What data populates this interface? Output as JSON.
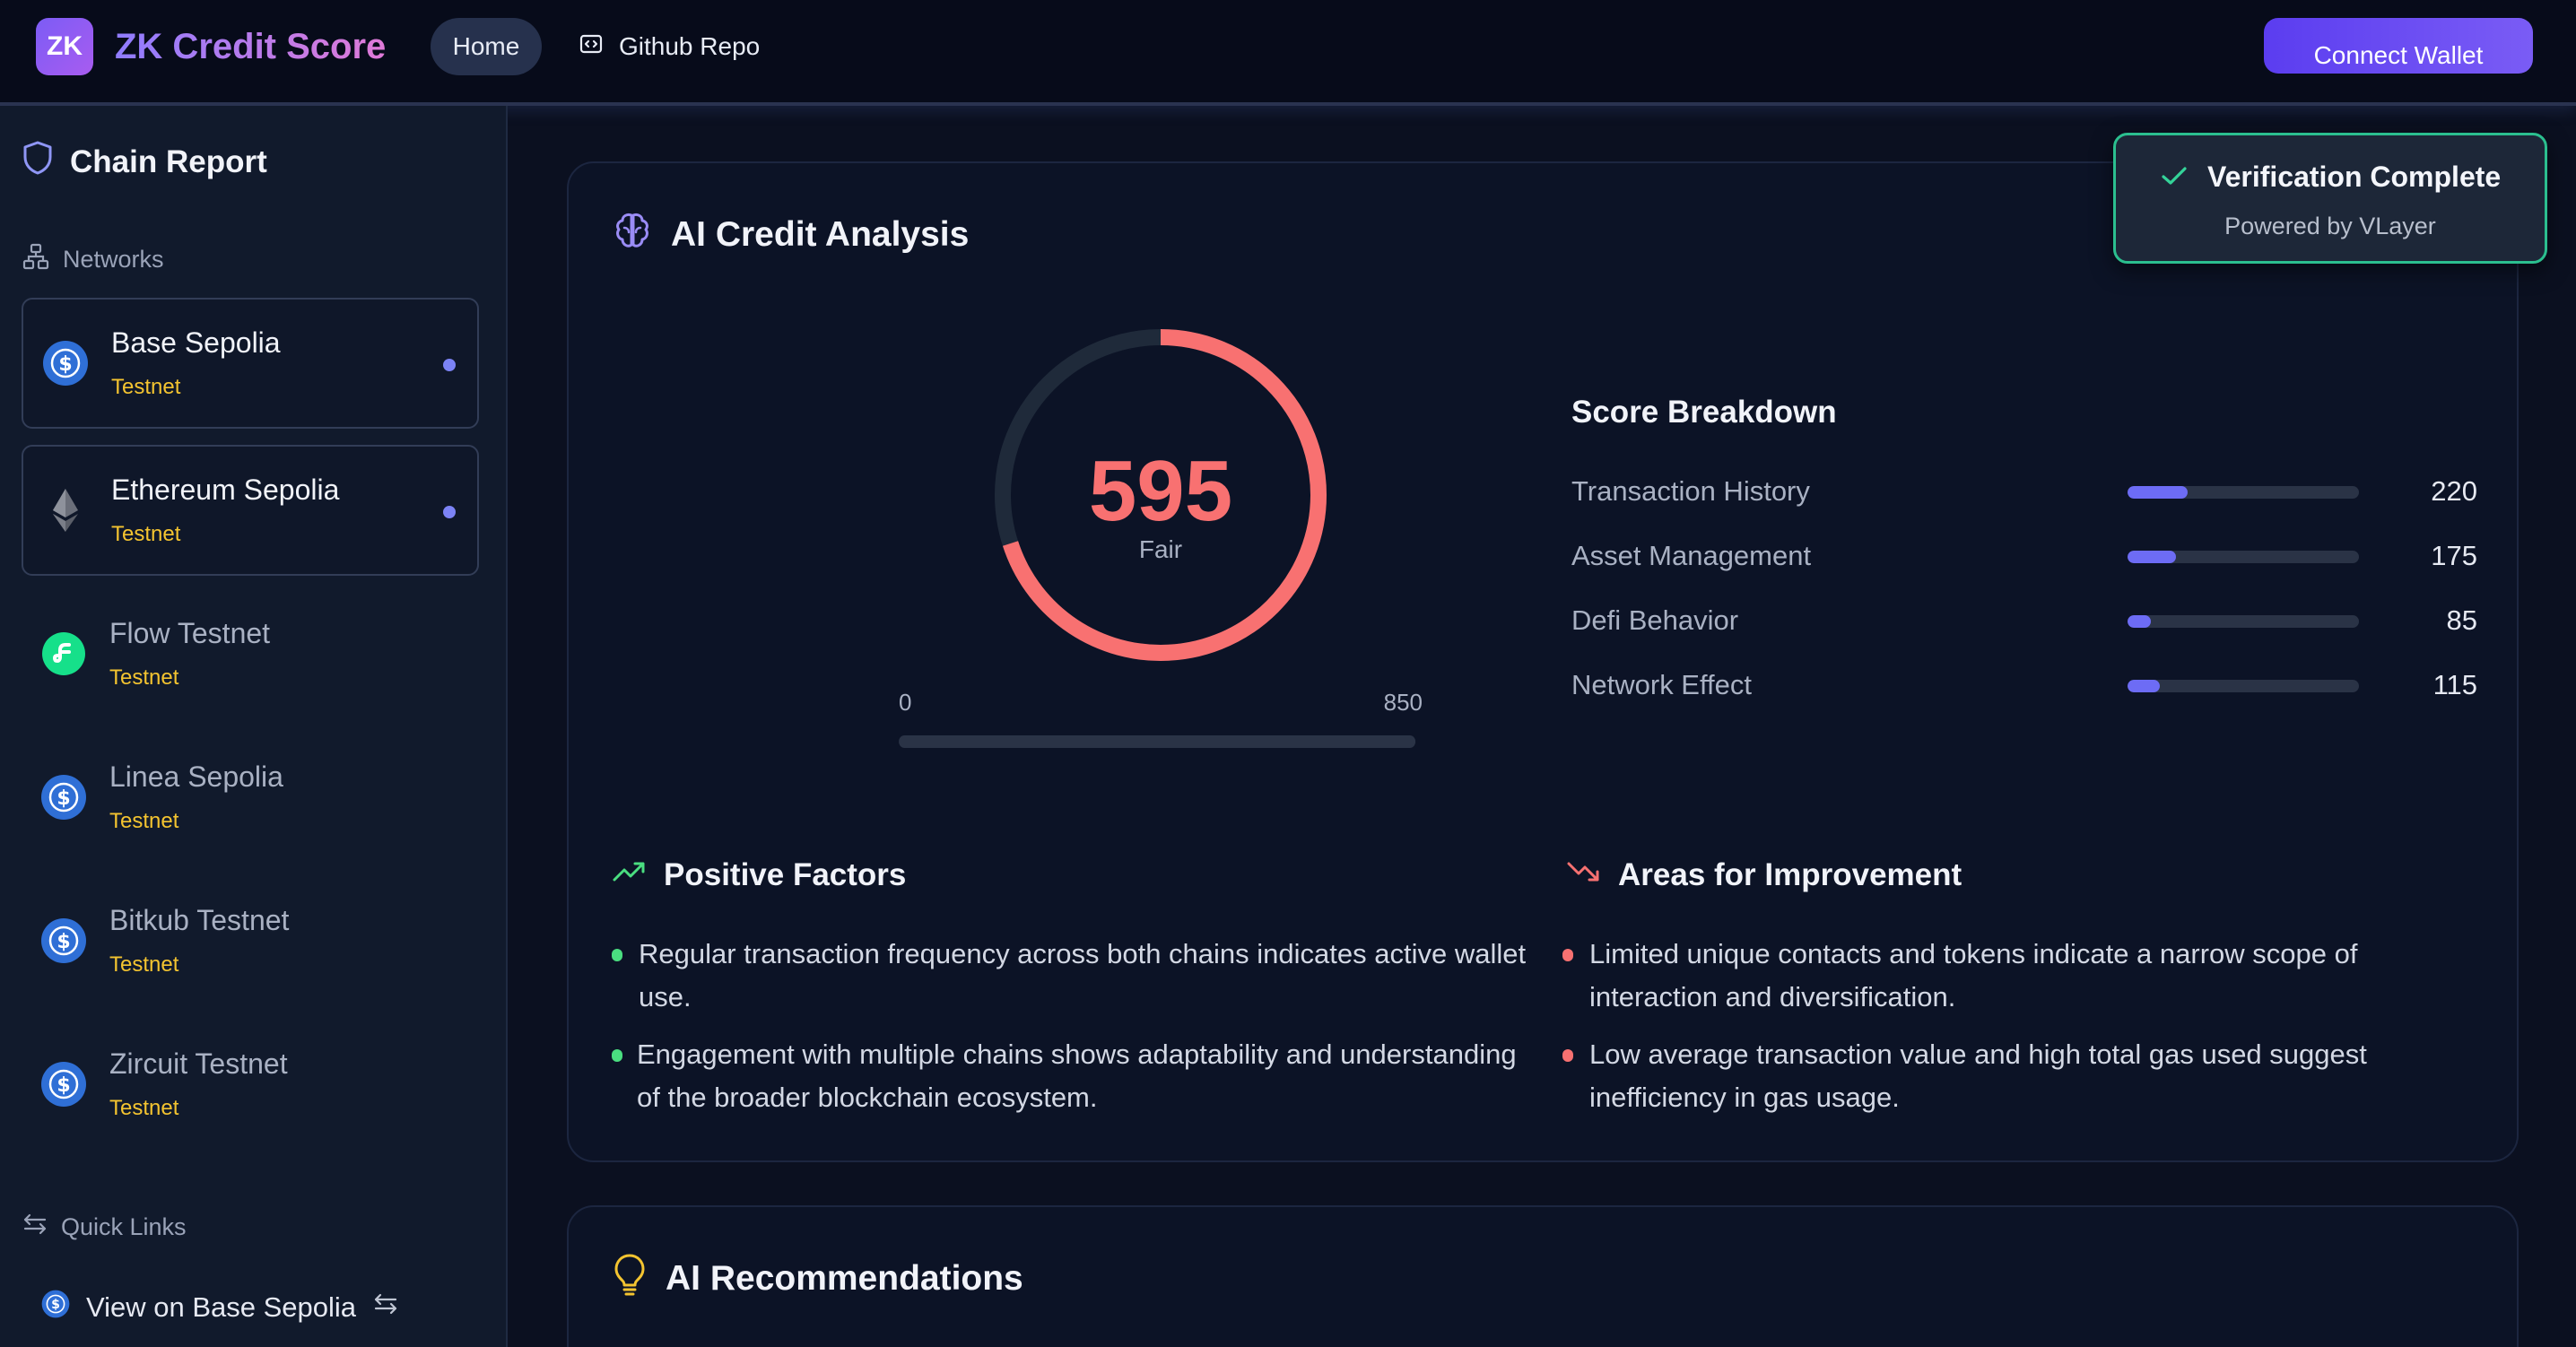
{
  "app": {
    "logo_text": "ZK",
    "title": "ZK Credit Score"
  },
  "nav": {
    "home_label": "Home",
    "github_label": "Github Repo",
    "connect_label": "Connect Wallet"
  },
  "sidebar": {
    "title": "Chain Report",
    "networks_label": "Networks",
    "networks": [
      {
        "name": "Base Sepolia",
        "tag": "Testnet",
        "icon": "usdc-icon",
        "active": true
      },
      {
        "name": "Ethereum Sepolia",
        "tag": "Testnet",
        "icon": "ethereum-icon",
        "active": true
      },
      {
        "name": "Flow Testnet",
        "tag": "Testnet",
        "icon": "flow-icon",
        "active": false
      },
      {
        "name": "Linea Sepolia",
        "tag": "Testnet",
        "icon": "usdc-icon",
        "active": false
      },
      {
        "name": "Bitkub Testnet",
        "tag": "Testnet",
        "icon": "usdc-icon",
        "active": false
      },
      {
        "name": "Zircuit Testnet",
        "tag": "Testnet",
        "icon": "usdc-icon",
        "active": false
      }
    ],
    "quick_links_label": "Quick Links",
    "quick_link": "View on Base Sepolia"
  },
  "analysis": {
    "title": "AI Credit Analysis",
    "score": "595",
    "score_value": 595,
    "score_max_value": 850,
    "rating": "Fair",
    "range_min": "0",
    "range_max": "850",
    "breakdown_title": "Score Breakdown",
    "breakdown": [
      {
        "label": "Transaction History",
        "value": "220",
        "fraction": 0.26
      },
      {
        "label": "Asset Management",
        "value": "175",
        "fraction": 0.21
      },
      {
        "label": "Defi Behavior",
        "value": "85",
        "fraction": 0.1
      },
      {
        "label": "Network Effect",
        "value": "115",
        "fraction": 0.14
      }
    ],
    "positive_title": "Positive Factors",
    "positive": [
      "Regular transaction frequency across both chains indicates active wallet use.",
      "Engagement with multiple chains shows adaptability and understanding of the broader blockchain ecosystem."
    ],
    "improve_title": "Areas for Improvement",
    "improve": [
      "Limited unique contacts and tokens indicate a narrow scope of interaction and diversification.",
      "Low average transaction value and high total gas used suggest inefficiency in gas usage."
    ]
  },
  "recommendations": {
    "title": "AI Recommendations"
  },
  "toast": {
    "title": "Verification Complete",
    "subtitle": "Powered by VLayer"
  },
  "colors": {
    "score": "#f87171",
    "accent": "#6d6cf5",
    "positive": "#4ade80",
    "negative": "#f87171",
    "testnet": "#f4c430"
  }
}
